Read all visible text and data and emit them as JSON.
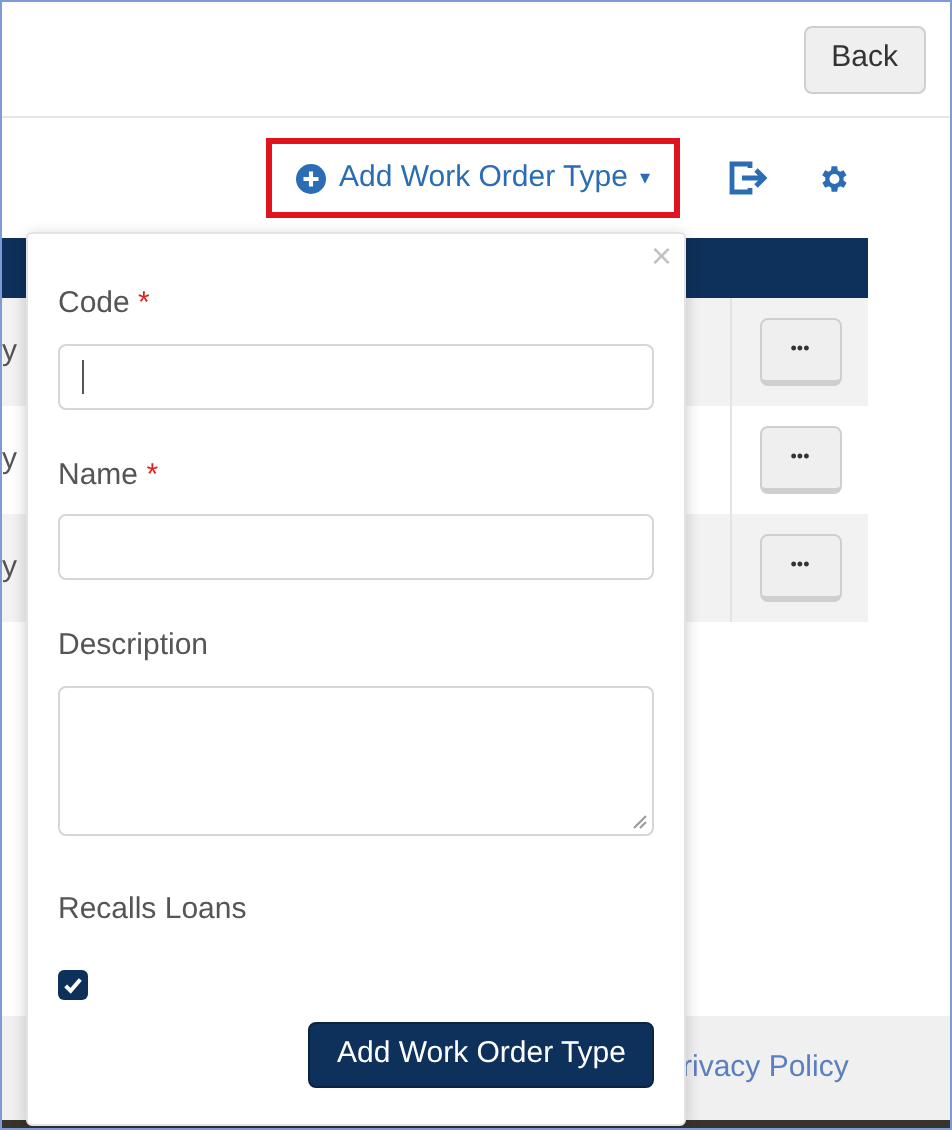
{
  "header": {
    "back_button": "Back"
  },
  "toolbar": {
    "add_menu": {
      "label": "Add Work Order Type",
      "caret": "▾",
      "highlighted": true
    }
  },
  "table": {
    "rows": [
      {
        "column_1": "y",
        "actions": "•••"
      },
      {
        "column_1": "y",
        "actions": "•••"
      },
      {
        "column_1": "y",
        "actions": "•••"
      }
    ]
  },
  "footer": {
    "link": "rivacy Policy"
  },
  "popover": {
    "close": "×",
    "fields": [
      {
        "kind": "input",
        "label": "Code",
        "required_mark": "*",
        "cursor": true
      },
      {
        "kind": "input",
        "label": "Name",
        "required_mark": "*"
      },
      {
        "kind": "textarea",
        "label": "Description"
      },
      {
        "kind": "checkbox",
        "label": "Recalls Loans",
        "checked": true
      }
    ],
    "submit": "Add Work Order Type"
  }
}
